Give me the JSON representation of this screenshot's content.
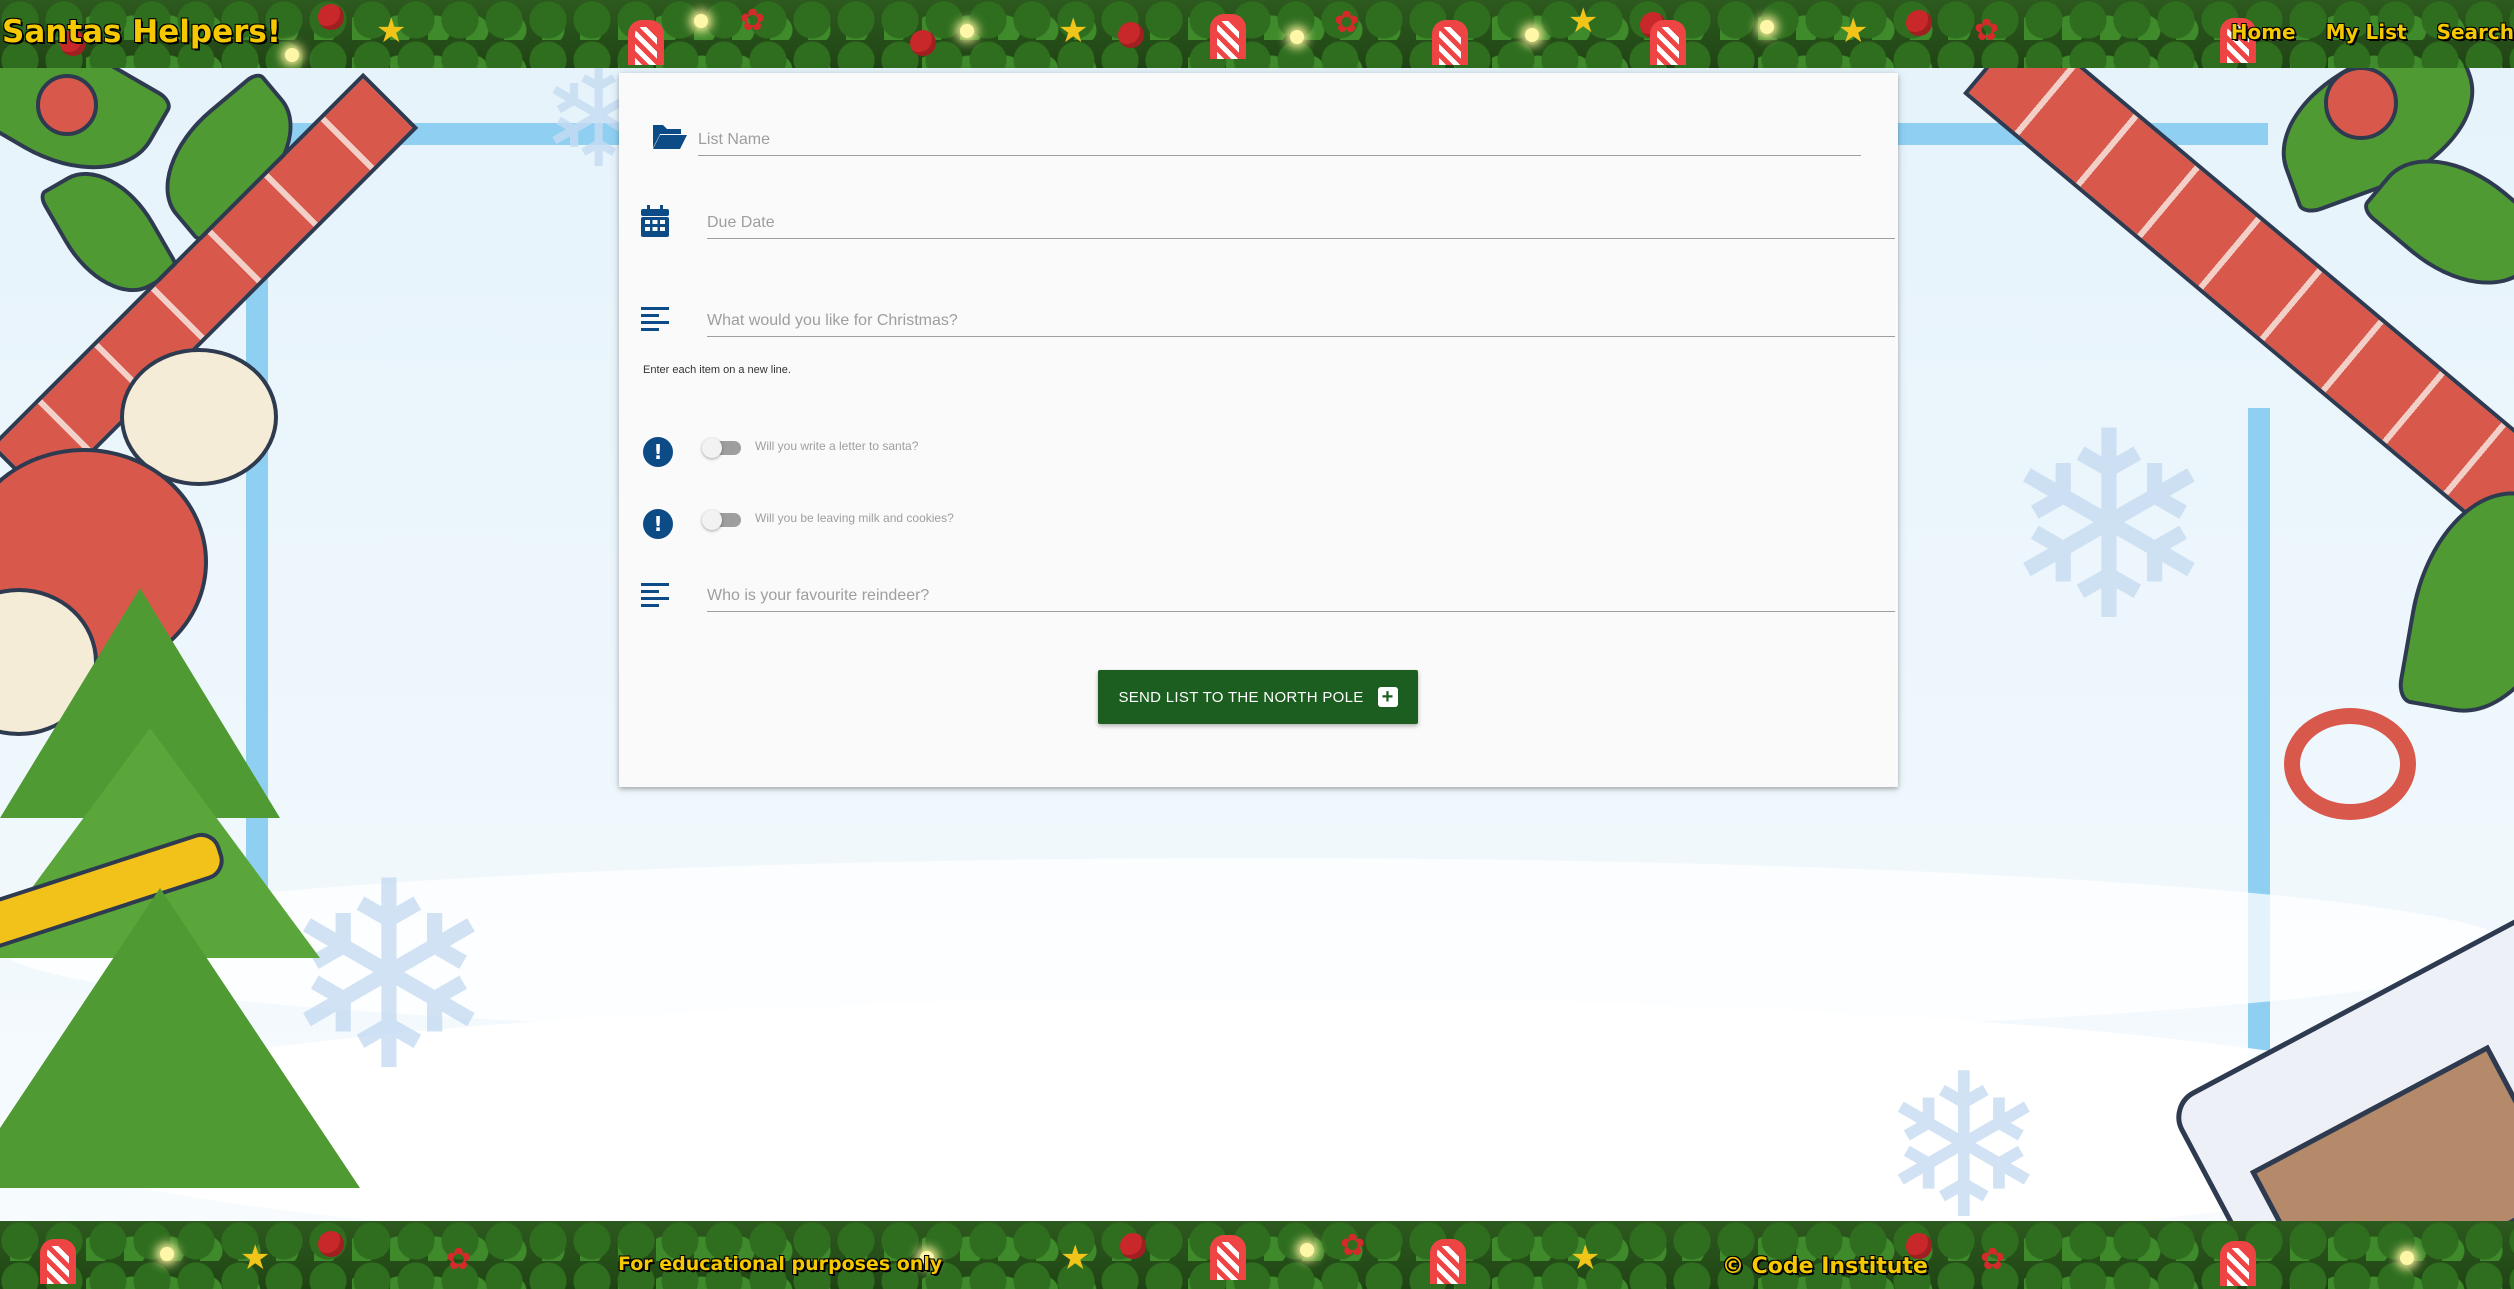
{
  "header": {
    "brand": "Santas Helpers!",
    "nav": [
      {
        "label": "Home"
      },
      {
        "label": "My List"
      },
      {
        "label": "Search"
      }
    ]
  },
  "form": {
    "list_name": {
      "placeholder": "List Name",
      "value": "",
      "icon": "folder-open-icon"
    },
    "due_date": {
      "placeholder": "Due Date",
      "value": "",
      "icon": "calendar-icon"
    },
    "wishes": {
      "placeholder": "What would you like for Christmas?",
      "value": "",
      "icon": "align-left-icon",
      "helper": "Enter each item on a new line."
    },
    "letter_toggle": {
      "label": "Will you write a letter to santa?",
      "checked": false,
      "icon": "exclamation-circle-icon"
    },
    "cookies_toggle": {
      "label": "Will you be leaving milk and cookies?",
      "checked": false,
      "icon": "exclamation-circle-icon"
    },
    "reindeer": {
      "placeholder": "Who is your favourite reindeer?",
      "value": "",
      "icon": "align-left-icon"
    },
    "submit_label": "SEND LIST TO THE NORTH POLE",
    "submit_icon": "plus-square-icon"
  },
  "footer": {
    "left": "For educational purposes only",
    "right": "© Code Institute"
  },
  "colors": {
    "accent": "#0d4b86",
    "button": "#1b5e20",
    "brand_text": "#f5c800"
  }
}
